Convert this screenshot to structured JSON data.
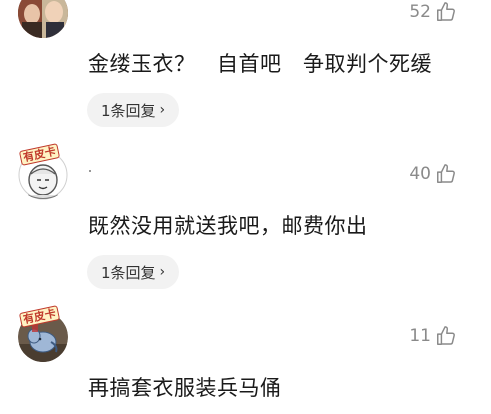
{
  "comments": [
    {
      "likes": "52",
      "text": "金缕玉衣？   自首吧   争取判个死缓",
      "reply_label": "1条回复"
    },
    {
      "avatar_badge": "有皮卡",
      "likes": "40",
      "text": "既然没用就送我吧，邮费你出",
      "reply_label": "1条回复"
    },
    {
      "avatar_badge": "有皮卡",
      "likes": "11",
      "text": "再搞套衣服装兵马俑"
    }
  ],
  "icons": {
    "like": "thumbs-up-outline-icon",
    "chevron": "chevron-right-icon"
  },
  "colors": {
    "like_count": "#8a8a8a",
    "text": "#1a1a1a",
    "pill_bg": "#f2f2f2",
    "badge": "#c0392b"
  }
}
